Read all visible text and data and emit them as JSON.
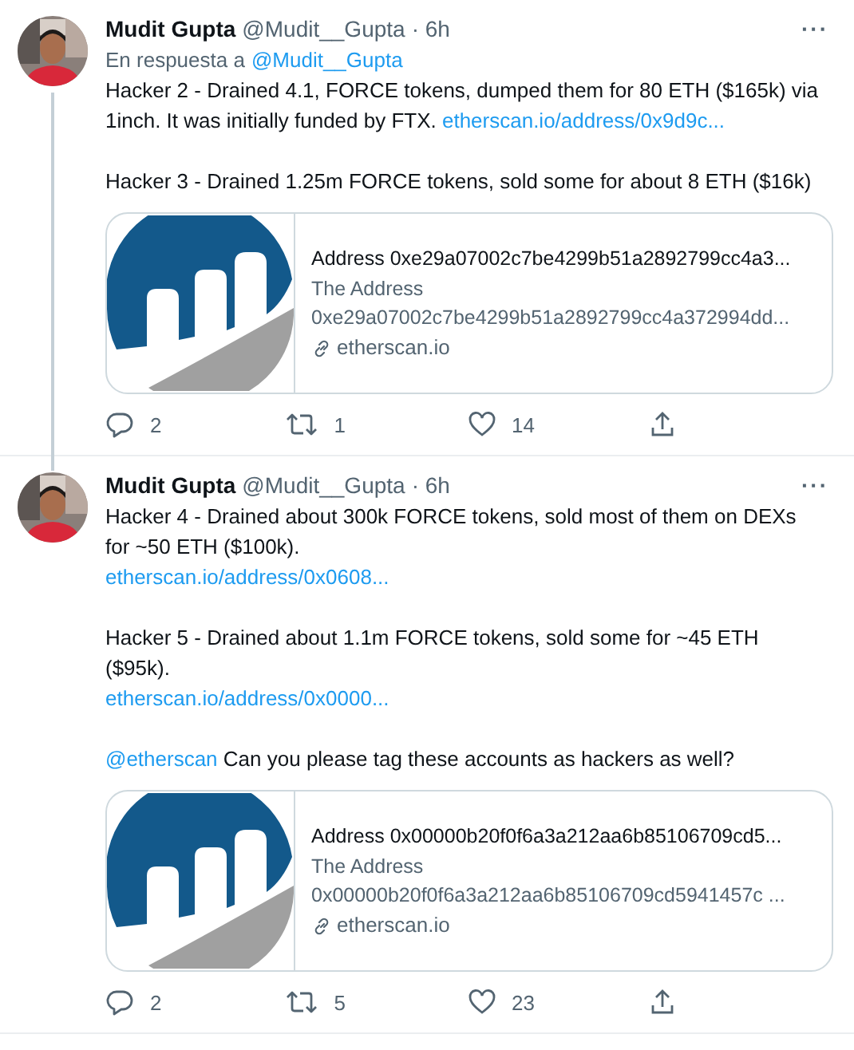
{
  "tweets": [
    {
      "name": "Mudit Gupta",
      "handle": "@Mudit__Gupta",
      "time": "· 6h",
      "more": "···",
      "thread_line": true,
      "reply_to": {
        "prefix": "En respuesta a",
        "mention": "@Mudit__Gupta"
      },
      "paragraphs": [
        [
          [
            {
              "kind": "text",
              "text": "Hacker 2 - Drained 4.1, FORCE tokens, dumped them for 80 ETH ($165k) via"
            }
          ],
          [
            {
              "kind": "text",
              "text": "1inch. It was initially funded by FTX. "
            },
            {
              "kind": "link",
              "text": "etherscan.io/address/0x9d9c..."
            }
          ]
        ],
        [
          [
            {
              "kind": "text",
              "text": "Hacker 3 - Drained 1.25m FORCE tokens, sold some for about 8 ETH ($16k)"
            }
          ]
        ]
      ],
      "card": {
        "title": "Address 0xe29a07002c7be4299b51a2892799cc4a3...",
        "description": "The Address 0xe29a07002c7be4299b51a2892799cc4a372994dd...",
        "domain": "etherscan.io"
      },
      "actions": {
        "replies": "2",
        "retweets": "1",
        "likes": "14"
      }
    },
    {
      "name": "Mudit Gupta",
      "handle": "@Mudit__Gupta",
      "time": "· 6h",
      "more": "···",
      "thread_line": false,
      "paragraphs": [
        [
          [
            {
              "kind": "text",
              "text": "Hacker 4 - Drained about 300k FORCE tokens, sold most of them on DEXs"
            }
          ],
          [
            {
              "kind": "text",
              "text": "for ~50 ETH ($100k)."
            }
          ],
          [
            {
              "kind": "link",
              "text": "etherscan.io/address/0x0608..."
            }
          ]
        ],
        [
          [
            {
              "kind": "text",
              "text": "Hacker 5 - Drained about 1.1m FORCE tokens, sold some for ~45 ETH"
            }
          ],
          [
            {
              "kind": "text",
              "text": "($95k)."
            }
          ],
          [
            {
              "kind": "link",
              "text": "etherscan.io/address/0x0000..."
            }
          ]
        ],
        [
          [
            {
              "kind": "mention",
              "text": "@etherscan"
            },
            {
              "kind": "text",
              "text": " Can you please tag these accounts as hackers as well?"
            }
          ]
        ]
      ],
      "card": {
        "title": "Address 0x00000b20f0f6a3a212aa6b85106709cd5...",
        "description": "The Address 0x00000b20f0f6a3a212aa6b85106709cd5941457c ...",
        "domain": "etherscan.io"
      },
      "actions": {
        "replies": "2",
        "retweets": "5",
        "likes": "23"
      }
    }
  ]
}
